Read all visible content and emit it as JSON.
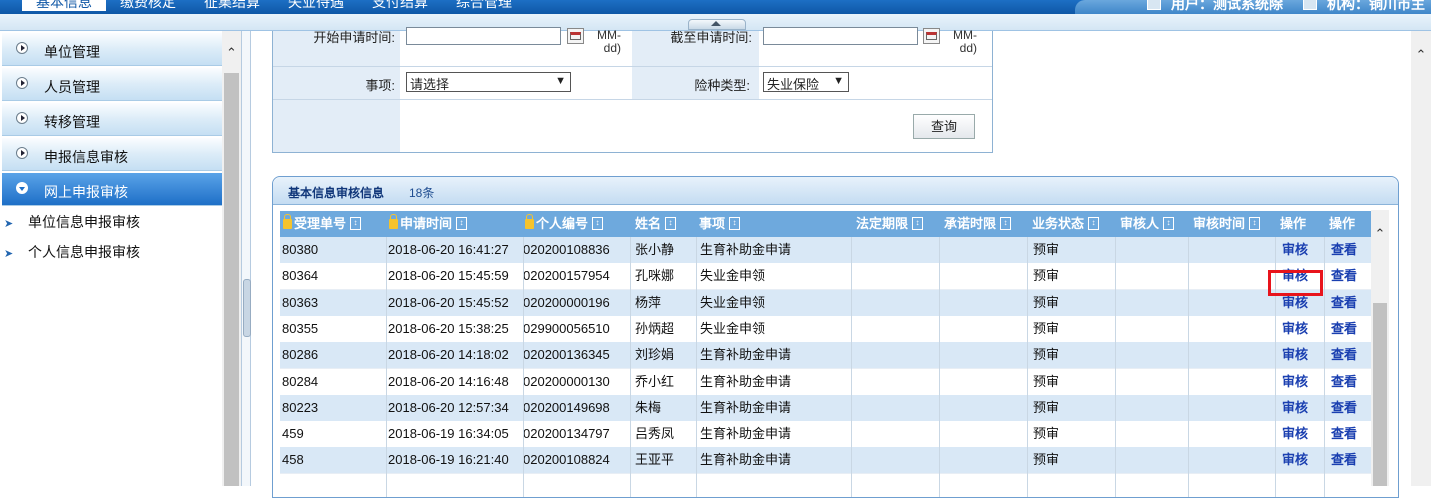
{
  "topnav": {
    "items": [
      "基本信息",
      "缴费核定",
      "征集结算",
      "失业待遇",
      "支付结算",
      "综合管理"
    ]
  },
  "userinfo": {
    "user_label": "用户：测试系统除",
    "org_label": "机构：铜川市主"
  },
  "sidebar": {
    "items": [
      {
        "label": "单位管理"
      },
      {
        "label": "人员管理"
      },
      {
        "label": "转移管理"
      },
      {
        "label": "申报信息审核"
      },
      {
        "label": "网上申报审核"
      }
    ],
    "subitems": [
      {
        "label": "单位信息申报审核"
      },
      {
        "label": "个人信息申报审核"
      }
    ]
  },
  "form": {
    "start_label": "开始申请时间:",
    "end_label": "截至申请时间:",
    "date_hint_1": "MM-",
    "date_hint_2": "dd)",
    "matter_label": "事项:",
    "matter_value": "请选择",
    "insurance_label": "险种类型:",
    "insurance_value": "失业保险",
    "query_label": "查询"
  },
  "panel": {
    "title": "基本信息审核信息",
    "count": "18条"
  },
  "table": {
    "columns": [
      "受理单号",
      "申请时间",
      "个人编号",
      "姓名",
      "事项",
      "法定期限",
      "承诺时限",
      "业务状态",
      "审核人",
      "审核时间",
      "操作",
      "操作"
    ],
    "audit_label": "审核",
    "view_label": "查看",
    "rows": [
      {
        "id": "80380",
        "time": "2018-06-20 16:41:27",
        "pid": "020200108836",
        "name": "张小静",
        "matter": "生育补助金申请",
        "status": "预审"
      },
      {
        "id": "80364",
        "time": "2018-06-20 15:45:59",
        "pid": "020200157954",
        "name": "孔咪娜",
        "matter": "失业金申领",
        "status": "预审"
      },
      {
        "id": "80363",
        "time": "2018-06-20 15:45:52",
        "pid": "020200000196",
        "name": "杨萍",
        "matter": "失业金申领",
        "status": "预审"
      },
      {
        "id": "80355",
        "time": "2018-06-20 15:38:25",
        "pid": "029900056510",
        "name": "孙炳超",
        "matter": "失业金申领",
        "status": "预审"
      },
      {
        "id": "80286",
        "time": "2018-06-20 14:18:02",
        "pid": "020200136345",
        "name": "刘珍娟",
        "matter": "生育补助金申请",
        "status": "预审"
      },
      {
        "id": "80284",
        "time": "2018-06-20 14:16:48",
        "pid": "020200000130",
        "name": "乔小红",
        "matter": "生育补助金申请",
        "status": "预审"
      },
      {
        "id": "80223",
        "time": "2018-06-20 12:57:34",
        "pid": "020200149698",
        "name": "朱梅",
        "matter": "生育补助金申请",
        "status": "预审"
      },
      {
        "id": "459",
        "time": "2018-06-19 16:34:05",
        "pid": "020200134797",
        "name": "吕秀凤",
        "matter": "生育补助金申请",
        "status": "预审"
      },
      {
        "id": "458",
        "time": "2018-06-19 16:21:40",
        "pid": "020200108824",
        "name": "王亚平",
        "matter": "生育补助金申请",
        "status": "预审"
      }
    ]
  },
  "colors": {
    "accent": "#1e6fc7",
    "header": "#6ea9dd",
    "highlight": "#e8141c"
  }
}
